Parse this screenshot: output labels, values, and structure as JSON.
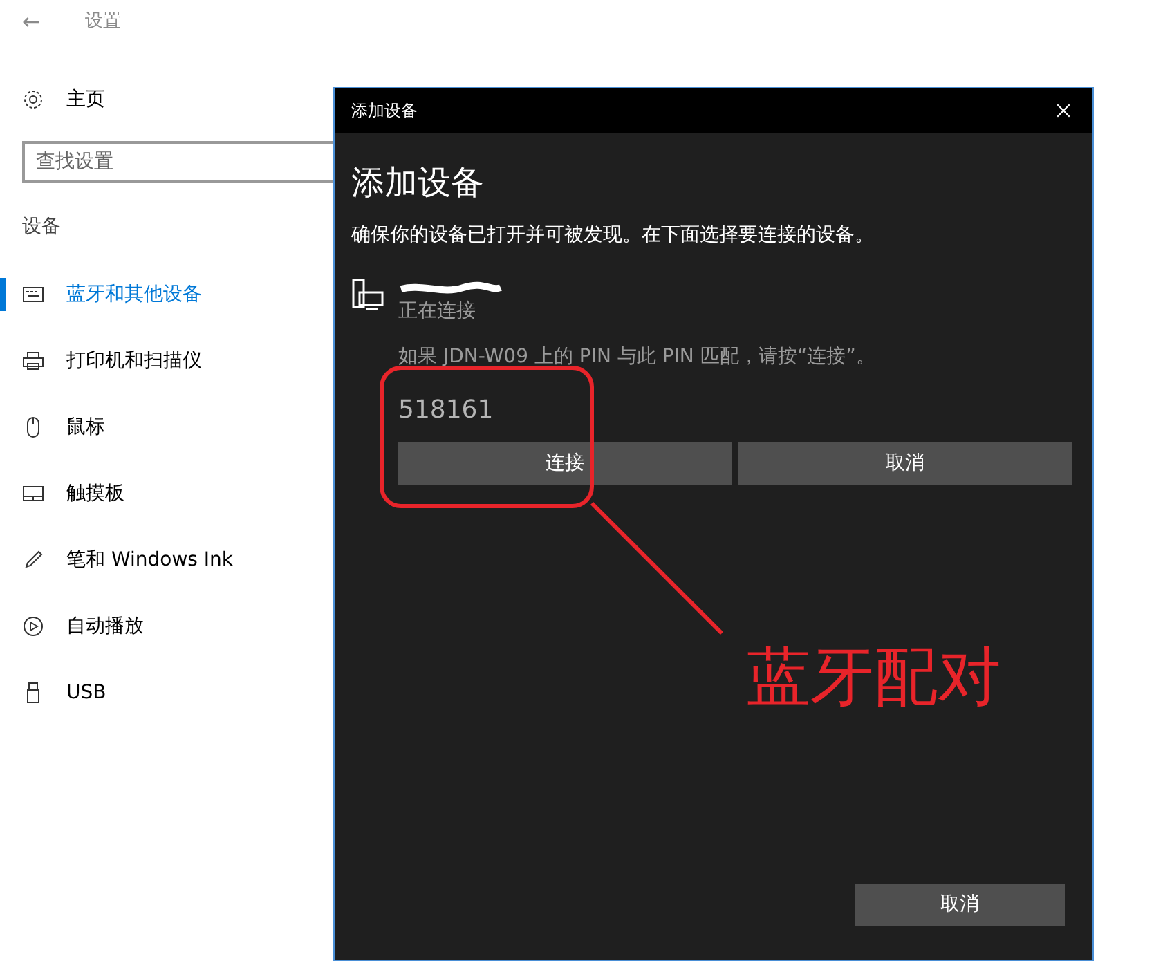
{
  "settings": {
    "back": "←",
    "title": "设置",
    "home": "主页",
    "search": {
      "placeholder": "查找设置"
    },
    "section": "设备",
    "nav": [
      {
        "label": "蓝牙和其他设备",
        "kind": "bluetooth",
        "selected": true
      },
      {
        "label": "打印机和扫描仪",
        "kind": "printer",
        "selected": false
      },
      {
        "label": "鼠标",
        "kind": "mouse",
        "selected": false
      },
      {
        "label": "触摸板",
        "kind": "touchpad",
        "selected": false
      },
      {
        "label": "笔和 Windows Ink",
        "kind": "pen",
        "selected": false
      },
      {
        "label": "自动播放",
        "kind": "autoplay",
        "selected": false
      },
      {
        "label": "USB",
        "kind": "usb",
        "selected": false
      }
    ]
  },
  "dialog": {
    "title": "添加设备",
    "heading": "添加设备",
    "instruction": "确保你的设备已打开并可被发现。在下面选择要连接的设备。",
    "device": {
      "status": "正在连接",
      "prompt": "如果 JDN-W09 上的 PIN 与此 PIN 匹配，请按“连接”。",
      "pin": "518161",
      "buttons": [
        "连接",
        "取消"
      ]
    },
    "footer_button": "取消"
  },
  "annotation": {
    "text": "蓝牙配对"
  }
}
